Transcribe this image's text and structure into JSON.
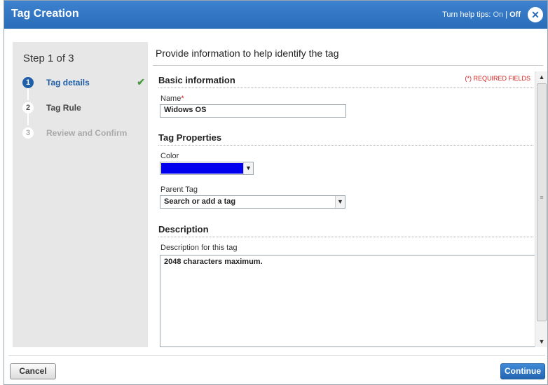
{
  "dialog": {
    "title": "Tag Creation",
    "help_tips_label": "Turn help tips:",
    "help_on": "On",
    "help_separator": "|",
    "help_off": "Off",
    "close_glyph": "✕"
  },
  "sidebar": {
    "step_title": "Step 1 of 3",
    "steps": [
      {
        "number": "1",
        "label": "Tag details",
        "state": "active",
        "check": "✔"
      },
      {
        "number": "2",
        "label": "Tag Rule",
        "state": "normal"
      },
      {
        "number": "3",
        "label": "Review and Confirm",
        "state": "disabled"
      }
    ]
  },
  "main": {
    "intro": "Provide information to help identify the tag",
    "required_note": "(*) REQUIRED FIELDS",
    "basic": {
      "heading": "Basic information",
      "name_label": "Name",
      "required_star": "*",
      "name_value": "Widows OS"
    },
    "properties": {
      "heading": "Tag Properties",
      "color_label": "Color",
      "color_value": "#0000ee",
      "parent_label": "Parent Tag",
      "parent_value": "Search or add a tag"
    },
    "description": {
      "heading": "Description",
      "label": "Description for this tag",
      "placeholder": "2048 characters maximum."
    }
  },
  "footer": {
    "cancel_label": "Cancel",
    "continue_label": "Continue"
  },
  "icons": {
    "close": "close-icon",
    "check": "check-icon",
    "dropdown": "chevron-down-icon",
    "scroll_up": "arrow-up-icon",
    "scroll_down": "arrow-down-icon"
  }
}
